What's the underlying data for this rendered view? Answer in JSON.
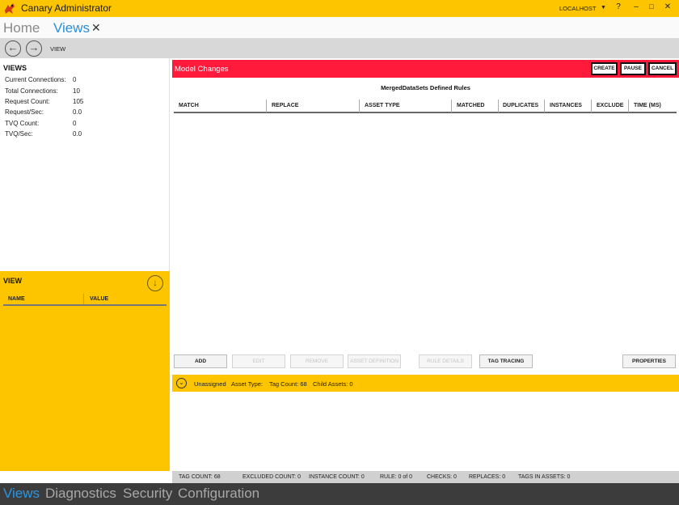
{
  "titlebar": {
    "title": "Canary Administrator",
    "server": "LOCALHOST",
    "server_dropdown_icon": "caret-down-icon",
    "help": "?",
    "minimize": "–",
    "maximize": "□",
    "close": "✕"
  },
  "tabs": {
    "home": "Home",
    "views": "Views",
    "close": "✕"
  },
  "navbar": {
    "back_icon": "arrow-left-icon",
    "forward_icon": "arrow-right-icon",
    "label": "VIEW"
  },
  "views_panel": {
    "title": "VIEWS",
    "stats": [
      {
        "label": "Current Connections:",
        "value": "0"
      },
      {
        "label": "Total Connections:",
        "value": "10"
      },
      {
        "label": "Request Count:",
        "value": "105"
      },
      {
        "label": "Request/Sec:",
        "value": "0.0"
      },
      {
        "label": "TVQ Count:",
        "value": "0"
      },
      {
        "label": "TVQ/Sec:",
        "value": "0.0"
      }
    ]
  },
  "view_panel": {
    "title": "VIEW",
    "col_name": "NAME",
    "col_value": "VALUE"
  },
  "main": {
    "title": "Model Changes",
    "buttons": {
      "create": "CREATE",
      "pause": "PAUSE",
      "cancel": "CANCEL"
    },
    "rules_title": "MergedDataSets Defined Rules",
    "columns": [
      "MATCH",
      "REPLACE",
      "ASSET TYPE",
      "MATCHED",
      "DUPLICATES",
      "INSTANCES",
      "EXCLUDE",
      "TIME (MS)"
    ],
    "actions": {
      "add": "ADD",
      "edit": "EDIT",
      "remove": "REMOVE",
      "asset_definition": "ASSET DEFINITION",
      "rule_details": "RULE DETAILS",
      "tag_tracing": "TAG TRACING",
      "properties": "PROPERTIES"
    }
  },
  "asset_bar": {
    "name": "Unassigned",
    "asset_type": "Asset Type:",
    "tag_count": "Tag Count: 68",
    "child_assets": "Child Assets: 0"
  },
  "status": {
    "tag_count": "TAG COUNT: 68",
    "excluded_count": "EXCLUDED COUNT: 0",
    "instance_count": "INSTANCE COUNT: 0",
    "rule": "RULE: 0 of 0",
    "checks": "CHECKS: 0",
    "replaces": "REPLACES: 0",
    "tags_in_assets": "TAGS IN ASSETS: 0"
  },
  "bottom_nav": {
    "views": "Views",
    "diagnostics": "Diagnostics",
    "security": "Security",
    "configuration": "Configuration"
  },
  "colors": {
    "accent_yellow": "#fcc500",
    "header_red": "#ff1a3c",
    "active_blue": "#2b8fd6"
  }
}
